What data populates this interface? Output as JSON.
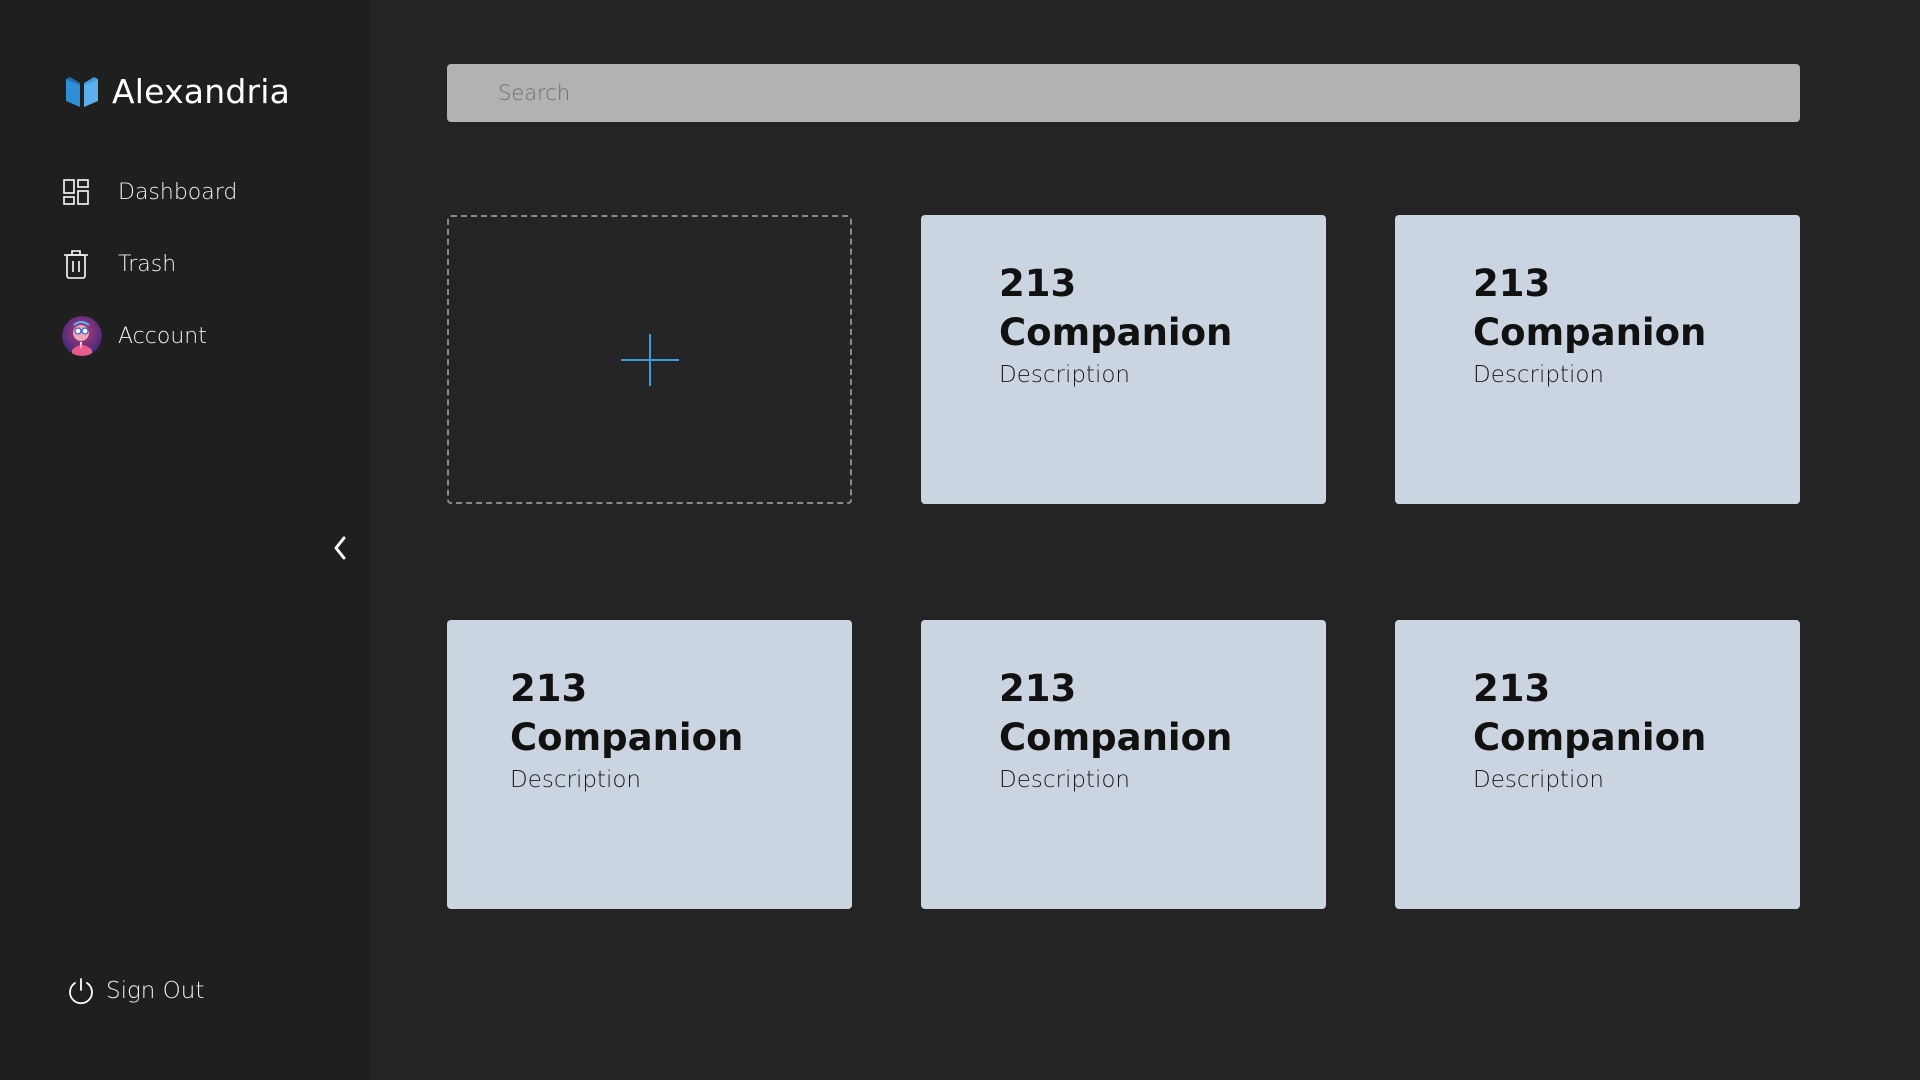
{
  "app": {
    "name": "Alexandria"
  },
  "sidebar": {
    "items": [
      {
        "label": "Dashboard",
        "icon": "dashboard-icon"
      },
      {
        "label": "Trash",
        "icon": "trash-icon"
      },
      {
        "label": "Account",
        "icon": "avatar"
      }
    ],
    "signout_label": "Sign Out",
    "collapse_icon": "chevron-left-icon"
  },
  "search": {
    "placeholder": "Search",
    "value": ""
  },
  "add_card": {
    "icon": "plus-icon"
  },
  "cards": [
    {
      "number": "213",
      "title": "Companion",
      "description": "Description"
    },
    {
      "number": "213",
      "title": "Companion",
      "description": "Description"
    },
    {
      "number": "213",
      "title": "Companion",
      "description": "Description"
    },
    {
      "number": "213",
      "title": "Companion",
      "description": "Description"
    },
    {
      "number": "213",
      "title": "Companion",
      "description": "Description"
    }
  ],
  "colors": {
    "background": "#242424",
    "sidebar": "#1f1f1f",
    "card": "#cbd5e1",
    "search": "#b2b2b2",
    "accent": "#3b9bdc"
  }
}
